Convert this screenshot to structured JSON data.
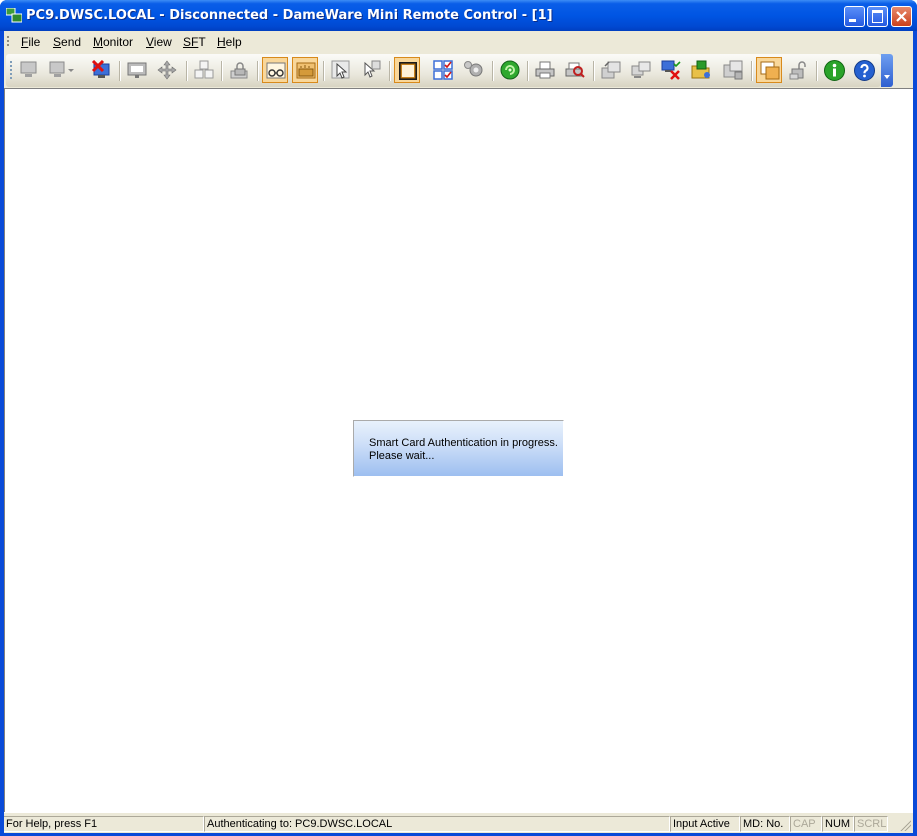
{
  "window": {
    "title": "PC9.DWSC.LOCAL - Disconnected - DameWare Mini Remote Control - [1]"
  },
  "menu": [
    {
      "label": "File",
      "accel": "F",
      "rest": "ile"
    },
    {
      "label": "Send",
      "accel": "S",
      "rest": "end"
    },
    {
      "label": "Monitor",
      "accel": "M",
      "rest": "onitor"
    },
    {
      "label": "View",
      "accel": "V",
      "rest": "iew"
    },
    {
      "label": "SFT",
      "accel": "SF",
      "rest": "T"
    },
    {
      "label": "Help",
      "accel": "H",
      "rest": "elp"
    }
  ],
  "toolbar": {
    "icons": [
      "connect-icon",
      "disconnect-dropdown-icon",
      "disconnect-icon",
      "remote-desktop-icon",
      "move-icon",
      "keyboard-letters-icon",
      "lock-keyboard-icon",
      "view-only-icon",
      "view-keyboard-icon",
      "select-pointer-icon",
      "pointer-alt-icon",
      "fullscreen-icon",
      "settings-grid-icon",
      "properties-gear-icon",
      "refresh-green-icon",
      "print-icon",
      "print-preview-icon",
      "transfer-icon",
      "copy-screen-icon",
      "disconnect-red-icon",
      "file-transfer-icon",
      "chat-icon",
      "window-overlay-icon",
      "unlock-icon",
      "info-icon",
      "help-icon"
    ]
  },
  "dialog": {
    "line1": "Smart Card Authentication in progress.",
    "line2": "Please wait..."
  },
  "status": {
    "help": "For Help, press F1",
    "auth": "Authenticating to: PC9.DWSC.LOCAL",
    "input": "Input Active",
    "md": "MD: No.",
    "cap": "CAP",
    "num": "NUM",
    "scrl": "SCRL"
  },
  "colors": {
    "titlebar": "#0055e3",
    "chrome": "#ece9d8",
    "dialog_bg": "#cfe0f8"
  }
}
